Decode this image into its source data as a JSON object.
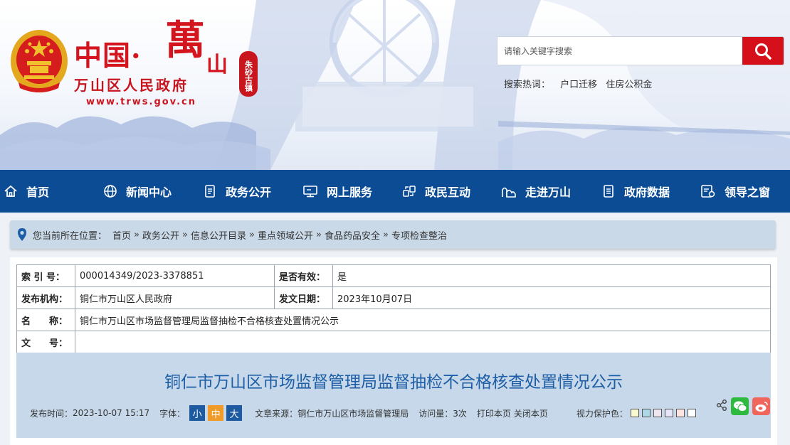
{
  "header": {
    "logo": {
      "title_cn": "中国·",
      "title_wan": "萬",
      "title_shan": "山",
      "seal_text": "朱砂古镇",
      "subtitle": "万山区人民政府",
      "url": "www.trws.gov.cn"
    },
    "search": {
      "placeholder": "请输入关键字搜索"
    },
    "hot_words": {
      "label": "搜索热词：",
      "items": [
        "户口迁移",
        "住房公积金"
      ]
    }
  },
  "nav": {
    "items": [
      {
        "label": "首页",
        "icon": "home-icon"
      },
      {
        "label": "新闻中心",
        "icon": "globe-icon"
      },
      {
        "label": "政务公开",
        "icon": "document-icon"
      },
      {
        "label": "网上服务",
        "icon": "monitor-icon"
      },
      {
        "label": "政民互动",
        "icon": "interaction-icon"
      },
      {
        "label": "走进万山",
        "icon": "mountain-icon"
      },
      {
        "label": "政府数据",
        "icon": "data-icon"
      },
      {
        "label": "领导之窗",
        "icon": "leader-icon"
      }
    ]
  },
  "breadcrumb": {
    "prefix": "您当前所在位置：",
    "separator": "»",
    "items": [
      "首页",
      "政务公开",
      "信息公开目录",
      "重点领域公开",
      "食品药品安全",
      "专项检查整治"
    ]
  },
  "meta": {
    "index_label": "索 引 号：",
    "index_value": "000014349/2023-3378851",
    "valid_label": "是否有效：",
    "valid_value": "是",
    "org_label": "发布机构：",
    "org_value": "铜仁市万山区人民政府",
    "date_label": "发文日期：",
    "date_value": "2023年10月07日",
    "name_label": "名　　称：",
    "name_value": "铜仁市万山区市场监督管理局监督抽检不合格核查处置情况公示",
    "doc_label": "文　　号：",
    "doc_value": ""
  },
  "article": {
    "title": "铜仁市万山区市场监督管理局监督抽检不合格核查处置情况公示",
    "publish_label": "发布时间：",
    "publish_time": "2023-10-07 15:17",
    "font_label": "字体：",
    "font_small": "小",
    "font_mid": "中",
    "font_large": "大",
    "source_label": "文章来源：",
    "source_value": "铜仁市万山区市场监督管理局",
    "visits_label": "访问量：",
    "visits_value": "3次",
    "print_label": "打印本页",
    "close_label": "关闭本页",
    "vision_label": "视力保护色：",
    "vision_colors": [
      "#fafad2",
      "#add8e6",
      "#f0e6f0",
      "#e6e6fa",
      "#ffe4e1",
      "#ffffff"
    ]
  },
  "colors": {
    "brand_red": "#d6101b",
    "nav_blue": "#0b4c94",
    "title_blue": "#1e5ea6",
    "wechat_green": "#2dba3f",
    "weibo_red": "#f0665c"
  }
}
